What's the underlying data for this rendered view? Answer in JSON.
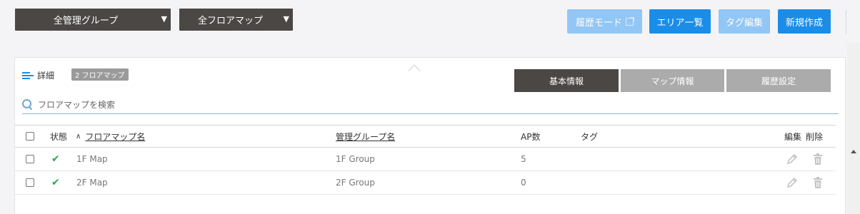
{
  "toolbar": {
    "group_select": "全管理グループ",
    "floor_select": "全フロアマップ",
    "history_mode": "履歴モード",
    "area_list": "エリア一覧",
    "tag_edit": "タグ編集",
    "new_create": "新規作成"
  },
  "panel": {
    "detail_label": "詳細",
    "count_badge": "2 フロアマップ",
    "tabs": [
      "基本情報",
      "マップ情報",
      "履歴設定"
    ],
    "search_placeholder": "フロアマップを検索"
  },
  "table": {
    "headers": {
      "status": "状態",
      "sort_indicator": "∧",
      "name": "フロアマップ名",
      "group": "管理グループ名",
      "ap_count": "AP数",
      "tag": "タグ",
      "edit": "編集",
      "delete": "削除"
    },
    "rows": [
      {
        "name": "1F Map",
        "group": "1F Group",
        "ap_count": "5",
        "tag": ""
      },
      {
        "name": "2F Map",
        "group": "2F Group",
        "ap_count": "0",
        "tag": ""
      }
    ]
  },
  "colors": {
    "accent": "#1a8de8",
    "accent_disabled": "#92c6f5",
    "dark_control": "#4a4745",
    "status_ok": "#2aa84a"
  },
  "icons": {
    "detail": "list-arrow-icon",
    "search": "search-icon",
    "status_ok": "checkmark-icon",
    "edit": "pencil-icon",
    "delete": "trash-icon",
    "external": "external-link-icon",
    "caret": "caret-down-icon"
  }
}
